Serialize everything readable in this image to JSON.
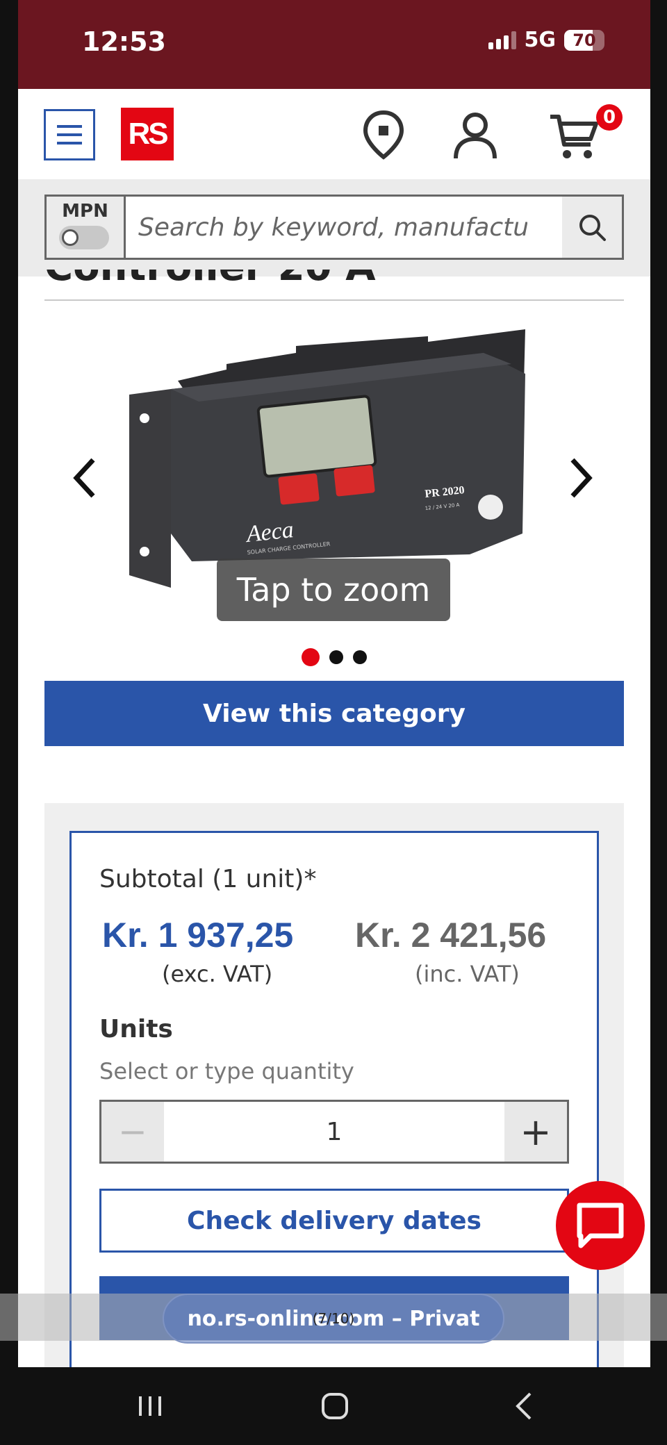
{
  "status_bar": {
    "time": "12:53",
    "network": "5G",
    "battery": "70",
    "battery_level": 0.7
  },
  "header": {
    "logo": "RS",
    "cart_count": "0"
  },
  "search": {
    "mpn_label": "MPN",
    "placeholder": "Search by keyword, manufactu..."
  },
  "product": {
    "title_partial": "Controller 20 A",
    "zoom_label": "Tap to zoom",
    "image_brand": "Aeca",
    "image_subtitle": "SOLAR CHARGE CONTROLLER",
    "image_model": "PR 2020",
    "image_spec": "12 / 24 V    20 A",
    "gallery_count": 3,
    "gallery_active": 1,
    "category_button": "View this category"
  },
  "pricing": {
    "subtotal_label": "Subtotal (1 unit)*",
    "price_exc": "Kr. 1 937,25",
    "price_exc_label": "(exc. VAT)",
    "price_inc": "Kr. 2 421,56",
    "price_inc_label": "(inc. VAT)",
    "units_title": "Units",
    "units_hint": "Select or type quantity",
    "quantity": "1",
    "minus": "−",
    "plus": "+",
    "delivery_button": "Check delivery dates"
  },
  "browser": {
    "url_label": "no.rs-online.com – Privat",
    "counter": "(7/10)"
  }
}
